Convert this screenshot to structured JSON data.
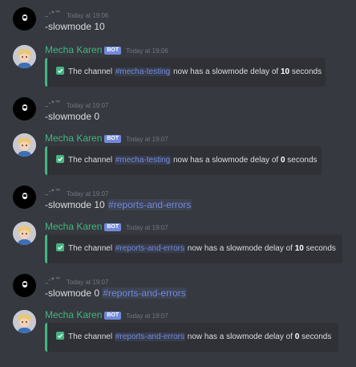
{
  "messages": [
    {
      "author": "_-*™",
      "timestamp": "Today at 19:06",
      "text": "-slowmode 10",
      "channel": ""
    },
    {
      "author": "Mecha Karen",
      "bot_tag": "BOT",
      "timestamp": "Today at 19:06",
      "embed_prefix": "The channel",
      "embed_channel": "#mecha-testing",
      "embed_middle": "now has a slowmode delay of",
      "embed_value": "10",
      "embed_suffix": "seconds"
    },
    {
      "author": "_-*™",
      "timestamp": "Today at 19:07",
      "text": "-slowmode 0",
      "channel": ""
    },
    {
      "author": "Mecha Karen",
      "bot_tag": "BOT",
      "timestamp": "Today at 19:07",
      "embed_prefix": "The channel",
      "embed_channel": "#mecha-testing",
      "embed_middle": "now has a slowmode delay of",
      "embed_value": "0",
      "embed_suffix": "seconds"
    },
    {
      "author": "_-*™",
      "timestamp": "Today at 19:07",
      "text": "-slowmode 10",
      "channel": "#reports-and-errors"
    },
    {
      "author": "Mecha Karen",
      "bot_tag": "BOT",
      "timestamp": "Today at 19:07",
      "embed_prefix": "The channel",
      "embed_channel": "#reports-and-errors",
      "embed_middle": "now has a slowmode delay of",
      "embed_value": "10",
      "embed_suffix": "seconds"
    },
    {
      "author": "_-*™",
      "timestamp": "Today at 19:07",
      "text": "-slowmode 0",
      "channel": "#reports-and-errors"
    },
    {
      "author": "Mecha Karen",
      "bot_tag": "BOT",
      "timestamp": "Today at 19:07",
      "embed_prefix": "The channel",
      "embed_channel": "#reports-and-errors",
      "embed_middle": "now has a slowmode delay of",
      "embed_value": "0",
      "embed_suffix": "seconds"
    }
  ],
  "colors": {
    "background": "#36393f",
    "embed_background": "#2f3136",
    "bot_name": "#43b581",
    "embed_accent": "#43b581",
    "mention": "#7289da",
    "bot_tag": "#7289da"
  }
}
